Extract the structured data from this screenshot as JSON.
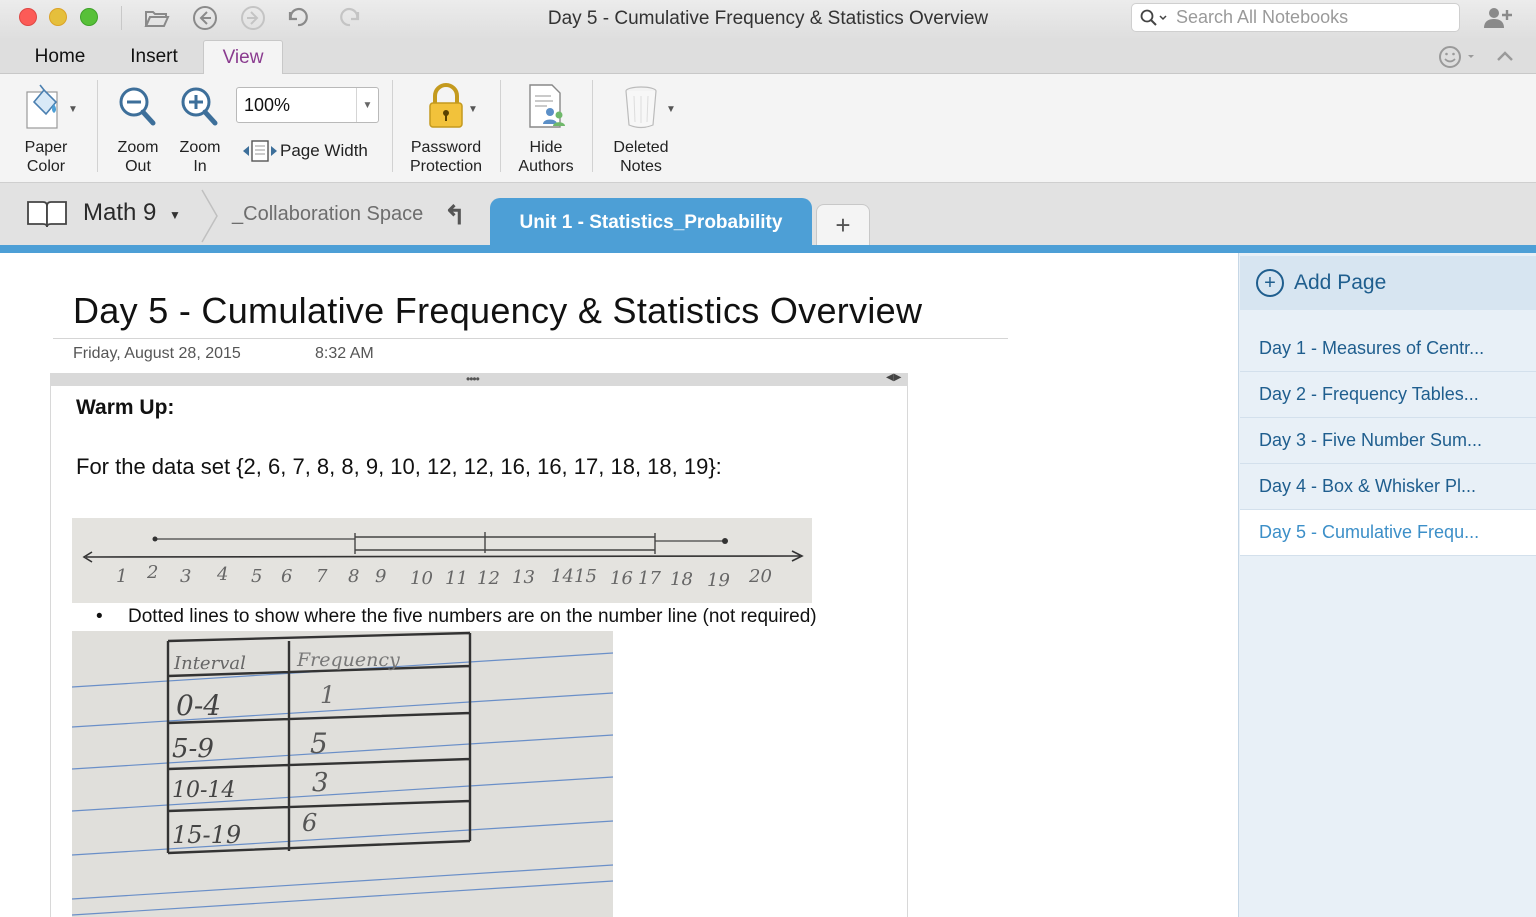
{
  "window": {
    "title": "Day 5 - Cumulative Frequency & Statistics Overview",
    "search_placeholder": "Search All Notebooks"
  },
  "menu_tabs": [
    {
      "label": "Home",
      "active": false
    },
    {
      "label": "Insert",
      "active": false
    },
    {
      "label": "View",
      "active": true
    }
  ],
  "ribbon": {
    "paper_color": "Paper\nColor",
    "zoom_out": "Zoom\nOut",
    "zoom_in": "Zoom\nIn",
    "zoom_value": "100%",
    "page_width": "Page Width",
    "password_protection": "Password\nProtection",
    "hide_authors": "Hide\nAuthors",
    "deleted_notes": "Deleted\nNotes"
  },
  "notebook": {
    "name": "Math 9",
    "sections": [
      {
        "label": "_Collaboration Space",
        "active": false
      },
      {
        "label": "Unit 1 - Statistics_Probability",
        "active": true
      }
    ],
    "add_section_label": "+"
  },
  "page": {
    "title": "Day 5 - Cumulative  Frequency  &  Statistics  Overview",
    "date": "Friday,  August  28,  2015",
    "time": "8:32  AM",
    "warmup_heading": "Warm Up:",
    "dataset_text": "For the data set {2, 6, 7, 8, 8, 9, 10, 12, 12, 16, 16, 17, 18, 18, 19}:",
    "bullet_text": "Dotted lines to show where the five numbers are on the number  line (not required)",
    "number_line_ticks": [
      "1",
      "2",
      "3",
      "4",
      "5",
      "6",
      "7",
      "8",
      "9",
      "10",
      "11",
      "12",
      "13",
      "14",
      "15",
      "16",
      "17",
      "18",
      "19",
      "20"
    ],
    "frequency_table": {
      "headers": [
        "Interval",
        "Frequency"
      ],
      "rows": [
        [
          "0-4",
          "1"
        ],
        [
          "5-9",
          "5"
        ],
        [
          "10-14",
          "3"
        ],
        [
          "15-19",
          "6"
        ]
      ]
    }
  },
  "sidebar": {
    "add_page": "Add Page",
    "pages": [
      {
        "label": "Day 1 - Measures of Centr...",
        "active": false
      },
      {
        "label": "Day 2 - Frequency Tables...",
        "active": false
      },
      {
        "label": "Day 3 - Five Number Sum...",
        "active": false
      },
      {
        "label": "Day 4 - Box & Whisker Pl...",
        "active": false
      },
      {
        "label": "Day 5 - Cumulative Frequ...",
        "active": true
      }
    ]
  },
  "colors": {
    "accent_blue": "#4d9fd6",
    "view_tab_purple": "#8a3b8f",
    "sidebar_text": "#1f5e8e"
  }
}
